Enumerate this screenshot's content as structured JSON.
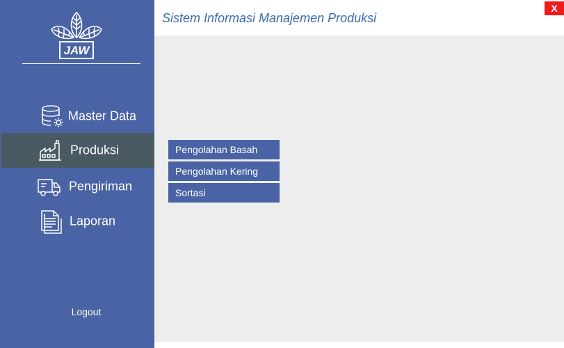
{
  "app": {
    "title": "Sistem Informasi Manajemen Produksi",
    "close_label": "X"
  },
  "logo": {
    "text": "JAW",
    "icon": "leaf-logo-icon"
  },
  "sidebar": {
    "items": [
      {
        "label": "Master Data",
        "icon": "database-settings-icon",
        "active": false
      },
      {
        "label": "Produksi",
        "icon": "factory-icon",
        "active": true
      },
      {
        "label": "Pengiriman",
        "icon": "delivery-truck-icon",
        "active": false
      },
      {
        "label": "Laporan",
        "icon": "report-document-icon",
        "active": false
      }
    ],
    "logout_label": "Logout"
  },
  "submenu": {
    "items": [
      {
        "label": "Pengolahan Basah"
      },
      {
        "label": "Pengolahan Kering"
      },
      {
        "label": "Sortasi"
      }
    ]
  },
  "colors": {
    "sidebar_bg": "#4a63a4",
    "sidebar_active_bg": "#4a5a63",
    "content_bg": "#ededed",
    "title_text": "#3c6ba8",
    "close_bg": "#ee1c1c",
    "submenu_bg": "#4a63a4"
  }
}
